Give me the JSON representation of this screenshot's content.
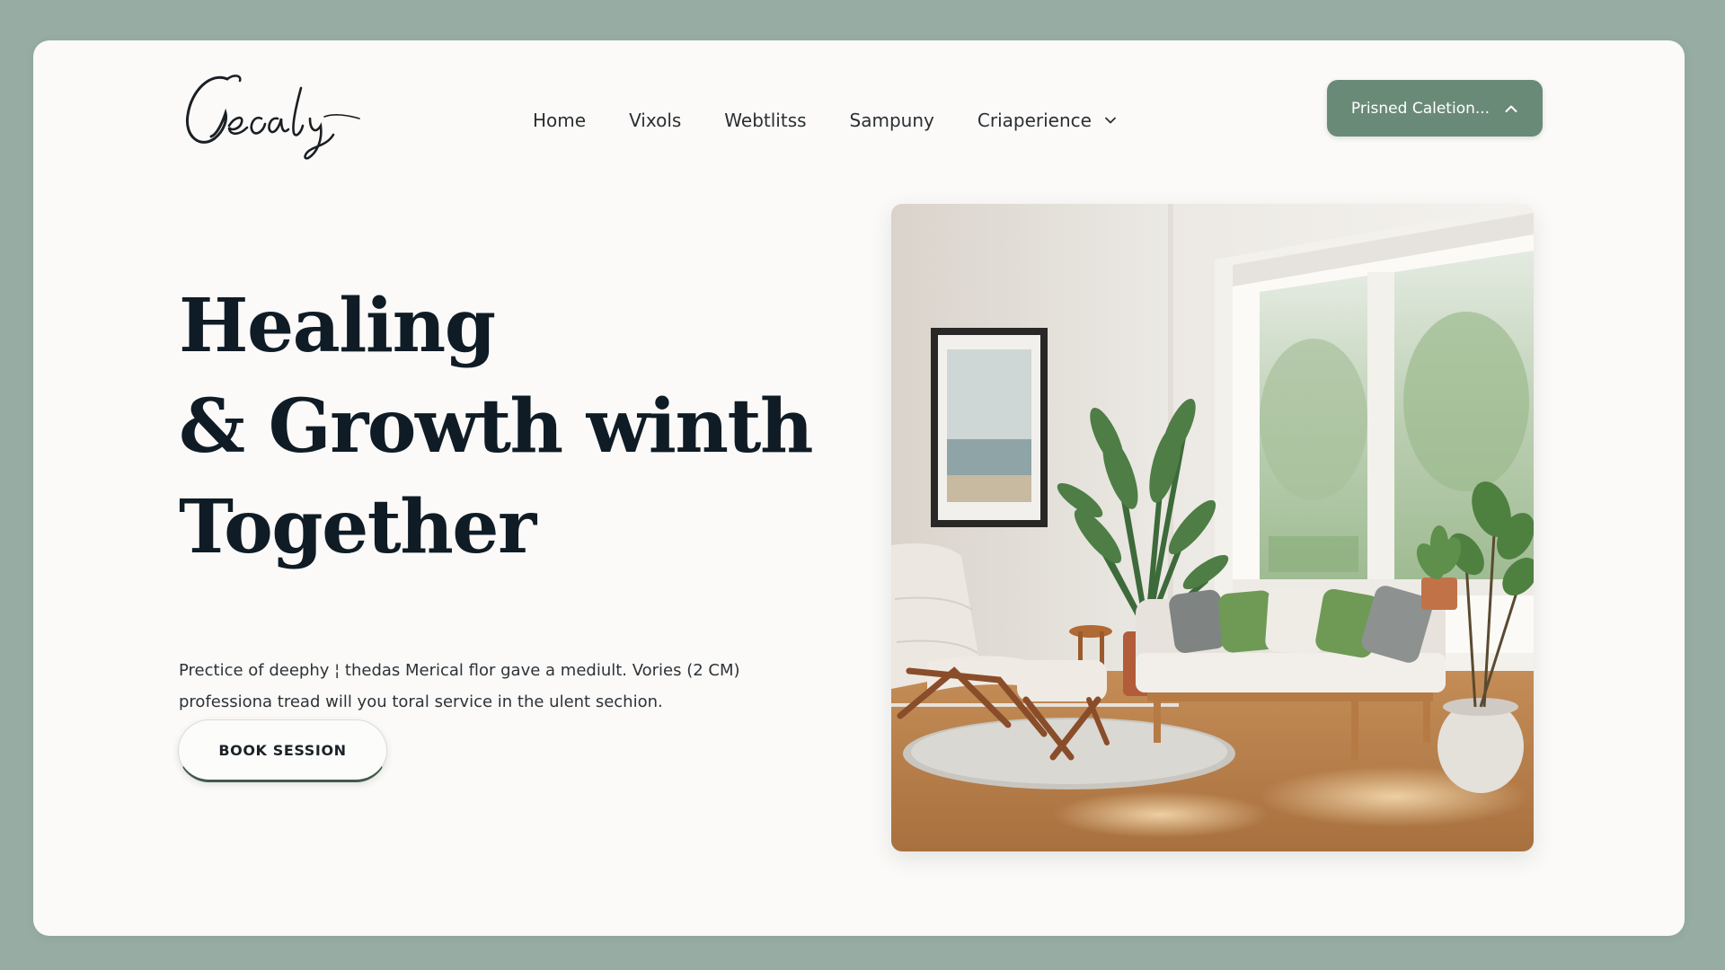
{
  "header": {
    "logo_text": "Gecaly",
    "nav": [
      {
        "label": "Home"
      },
      {
        "label": "Vixols"
      },
      {
        "label": "Webtlitss"
      },
      {
        "label": "Sampuny"
      },
      {
        "label": "Criaperience",
        "has_dropdown": true,
        "icon": "chevron-down-icon"
      }
    ],
    "cta": {
      "label": "Prisned Caletion...",
      "icon": "chevron-up-icon"
    }
  },
  "hero": {
    "title_lines": [
      "Healing",
      "& Growth winth",
      "Together"
    ],
    "description_lines": [
      "Prectice of deephy ¦ thedas Merical flor gave a mediult. Vories (2 CM)",
      "professiona tread will you toral service in the ulent sechion."
    ],
    "button_label": "BOOK SESSION",
    "image_alt": "therapy room with lounge chair, sofa, plants and large windows"
  },
  "colors": {
    "page_background": "#97ada3",
    "card_background": "#fbfaf8",
    "accent_green": "#6a8a78",
    "title_color": "#0f1c26",
    "text_color": "#2c3338"
  }
}
